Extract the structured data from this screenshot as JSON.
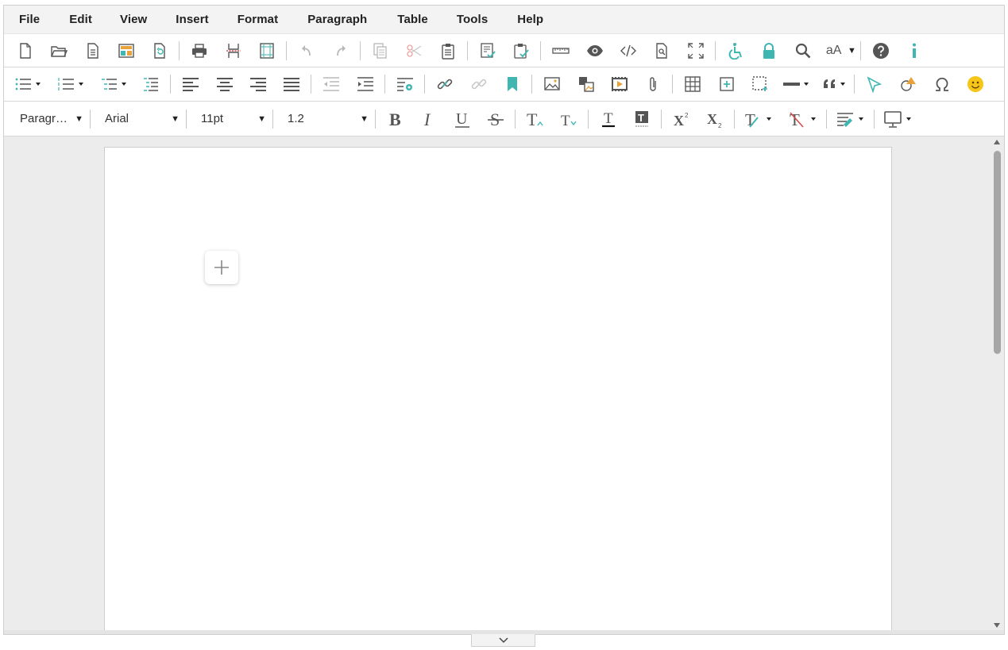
{
  "menubar": {
    "items": [
      {
        "label": "File"
      },
      {
        "label": "Edit"
      },
      {
        "label": "View"
      },
      {
        "label": "Insert"
      },
      {
        "label": "Format"
      },
      {
        "label": "Paragraph"
      },
      {
        "label": "Table"
      },
      {
        "label": "Tools"
      },
      {
        "label": "Help"
      }
    ]
  },
  "toolbar1": {
    "font_size_toggle_label": "aA"
  },
  "format_toolbar": {
    "block_format": "Paragr…",
    "font_family": "Arial",
    "font_size": "11pt",
    "line_height": "1.2"
  },
  "colors": {
    "accent_teal": "#3fb6b2",
    "icon_gray": "#555555",
    "disabled_gray": "#b8b8b8",
    "emoji_yellow": "#f5c518",
    "workspace_bg": "#ececec"
  }
}
